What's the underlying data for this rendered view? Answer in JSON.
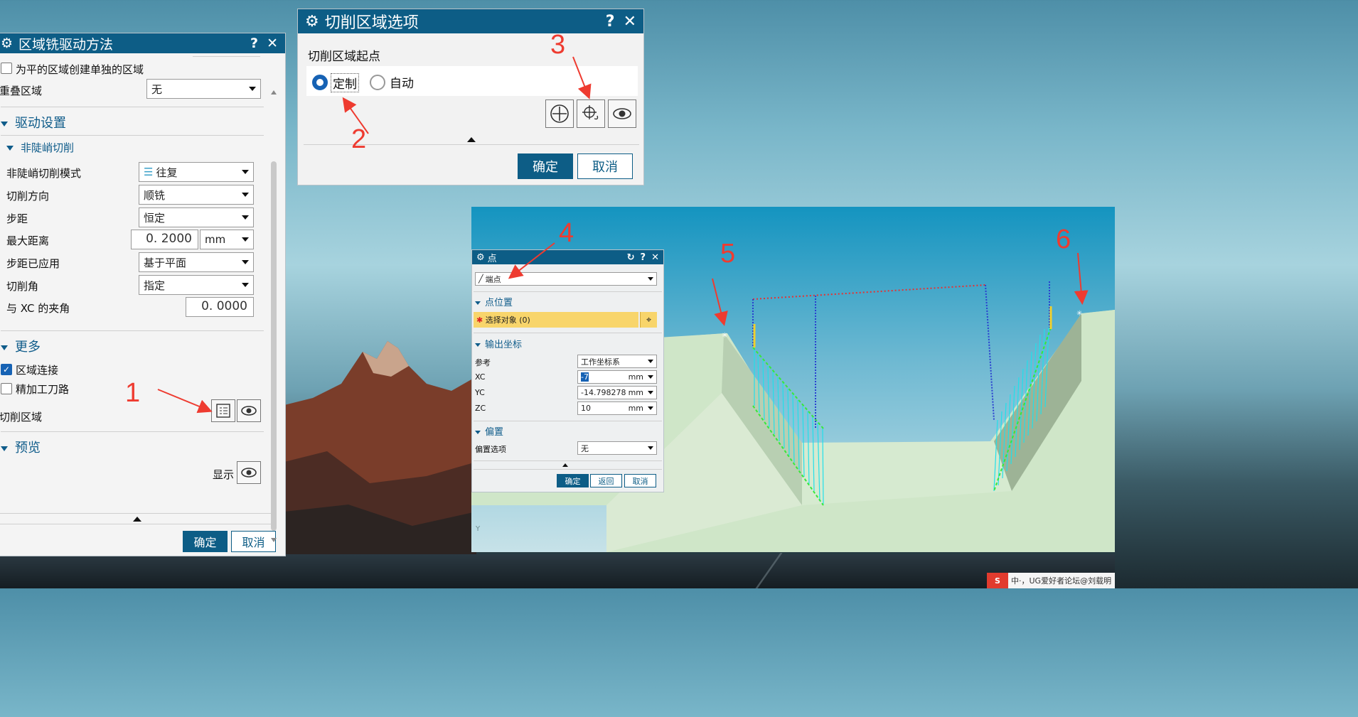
{
  "left_panel": {
    "title": "区域铣驱动方法",
    "help": "?",
    "close": "✕",
    "flat_area_checkbox": "为平的区域创建单独的区域",
    "overlap_label": "重叠区域",
    "overlap_value": "无",
    "drive_settings": "驱动设置",
    "non_steep": "非陡峭切削",
    "rows": [
      {
        "label": "非陡峭切削模式",
        "value": "往复"
      },
      {
        "label": "切削方向",
        "value": "顺铣"
      },
      {
        "label": "步距",
        "value": "恒定"
      },
      {
        "label": "最大距离",
        "value": "0. 2000",
        "unit": "mm"
      },
      {
        "label": "步距已应用",
        "value": "基于平面"
      },
      {
        "label": "切削角",
        "value": "指定"
      },
      {
        "label": "与 XC 的夹角",
        "value": "0. 0000"
      }
    ],
    "more": "更多",
    "region_connect": "区域连接",
    "finish_path": "精加工刀路",
    "cut_region": "切削区域",
    "preview": "预览",
    "display": "显示",
    "ok": "确定",
    "cancel": "取消"
  },
  "cut_dialog": {
    "title": "切削区域选项",
    "help": "?",
    "close": "✕",
    "start_point": "切削区域起点",
    "custom": "定制",
    "auto": "自动",
    "ok": "确定",
    "cancel": "取消"
  },
  "point_dialog": {
    "title": "点",
    "type_value": "端点",
    "point_location": "点位置",
    "select_object": "选择对象 (0)",
    "output_coords": "输出坐标",
    "reference_label": "参考",
    "reference_value": "工作坐标系",
    "xc_label": "XC",
    "xc_value": "-7",
    "yc_label": "YC",
    "yc_value": "-14.798278",
    "zc_label": "ZC",
    "zc_value": "10",
    "unit": "mm",
    "offset": "偏置",
    "offset_option_label": "偏置选项",
    "offset_option_value": "无",
    "ok": "确定",
    "back": "返回",
    "cancel": "取消"
  },
  "annotations": [
    "1",
    "2",
    "3",
    "4",
    "5",
    "6"
  ],
  "taskbar": {
    "ime_logo": "S",
    "ime_text": "中·，UG爱好者论坛@刘载明",
    "axis_label": "Y"
  },
  "colors": {
    "title_bar": "#0d5d86",
    "accent": "#0f5c8a",
    "annotation": "#ee3b30",
    "toolpath": "#21e0ea",
    "highlight": "#f8d56b"
  }
}
